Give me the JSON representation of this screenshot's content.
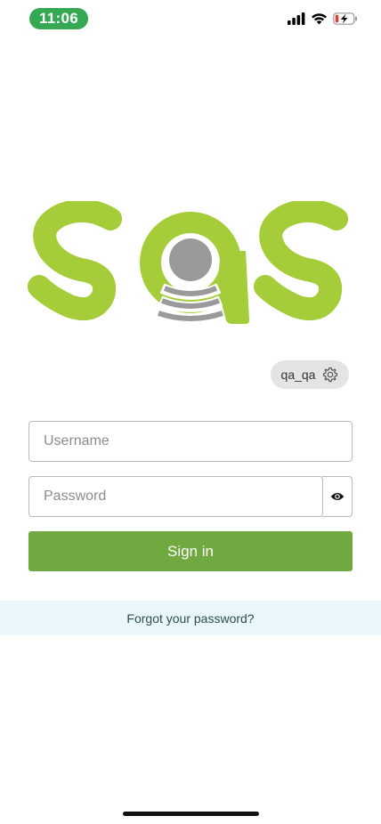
{
  "status_bar": {
    "time": "11:06"
  },
  "brand": {
    "logo_name": "sqs-logo",
    "green": "#a4cd39",
    "gray": "#9a9a9a"
  },
  "environment": {
    "label": "qa_qa",
    "icon": "gear-icon"
  },
  "login_form": {
    "username_placeholder": "Username",
    "username_value": "",
    "password_placeholder": "Password",
    "password_value": "",
    "password_toggle_icon": "eye-icon",
    "signin_label": "Sign in",
    "signin_color": "#6fa93f"
  },
  "footer": {
    "forgot_password": "Forgot your password?"
  }
}
